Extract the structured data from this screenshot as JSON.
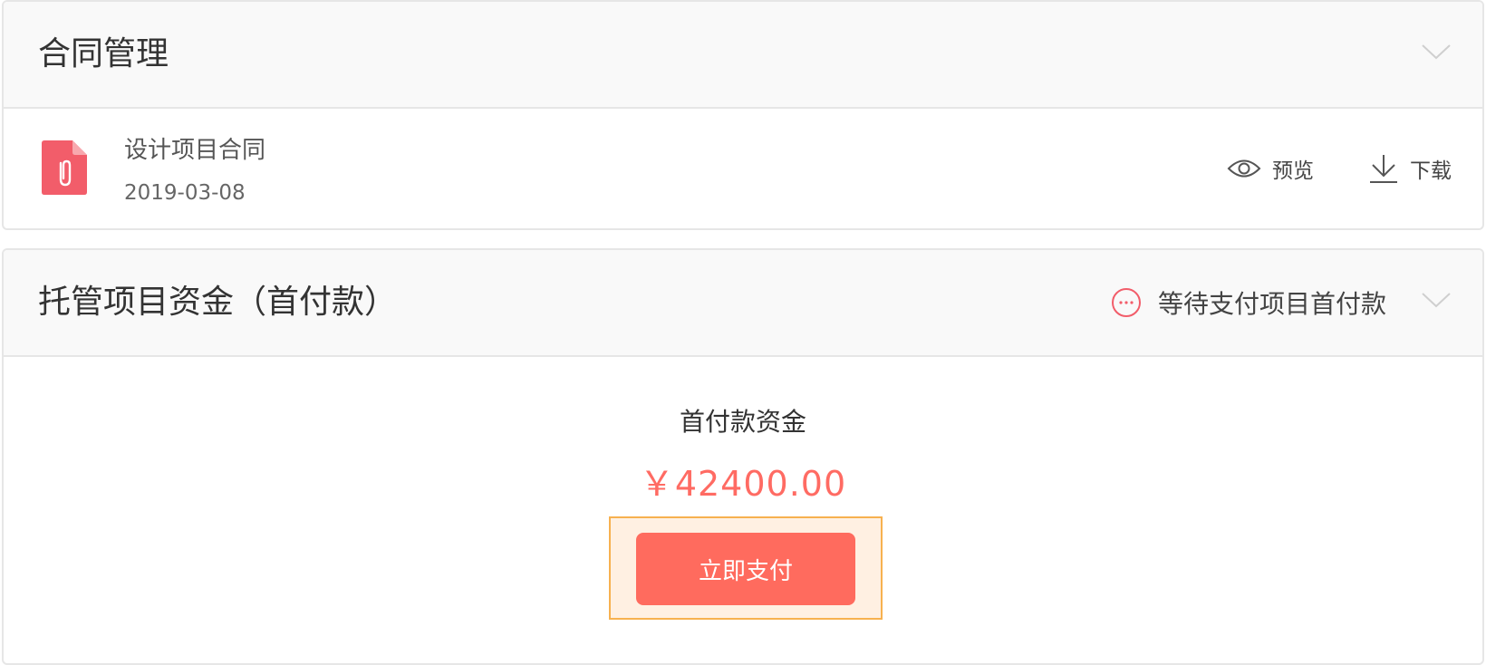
{
  "contract_section": {
    "title": "合同管理",
    "file": {
      "name": "设计项目合同",
      "date": "2019-03-08",
      "icon": "attachment-file-icon"
    },
    "actions": {
      "preview_label": "预览",
      "download_label": "下载"
    }
  },
  "escrow_section": {
    "title": "托管项目资金（首付款）",
    "status_label": "等待支付项目首付款",
    "amount_title": "首付款资金",
    "amount_value": "￥42400.00",
    "pay_button_label": "立即支付"
  },
  "colors": {
    "accent": "#ff6b63",
    "pay_button": "#ff6b5e",
    "highlight_border": "#f7b14f",
    "highlight_fill": "#fff0e2",
    "file_icon": "#f25d6a"
  }
}
